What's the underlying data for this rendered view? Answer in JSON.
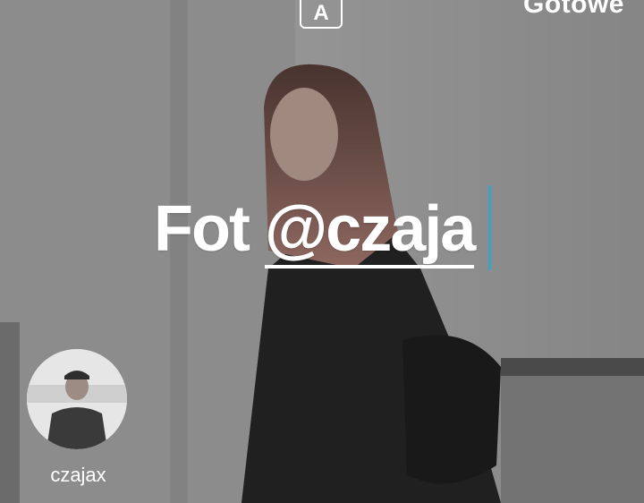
{
  "toolbar": {
    "text_style_label": "A",
    "done_label": "Gotowe"
  },
  "caption": {
    "prefix": "Fot",
    "mention": "@czaja"
  },
  "mention_suggestion": {
    "username": "czajax"
  },
  "colors": {
    "cursor": "#3aa3c8",
    "text": "#ffffff"
  }
}
